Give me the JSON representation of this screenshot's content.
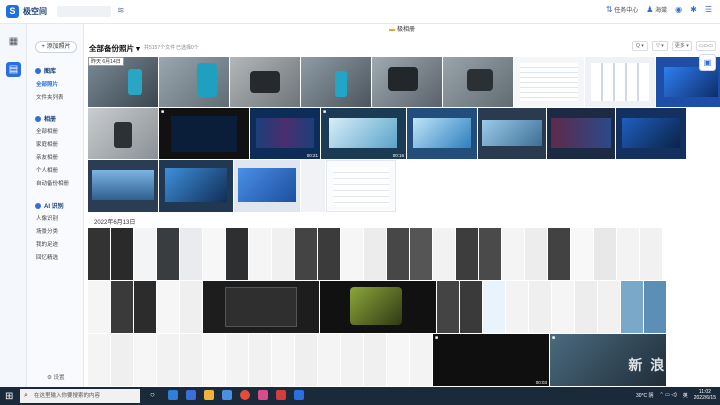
{
  "app": {
    "brand": "极空间",
    "window_title": "极相册"
  },
  "topbar": {
    "task_center": "任务中心",
    "user": "海棠",
    "task_icon": "tasks-icon",
    "bell_icon": "bell-icon",
    "gear_icon": "gear-icon",
    "user_icon": "user-icon"
  },
  "sidebar": {
    "add_button": "+ 添加照片",
    "sections": [
      {
        "label": "图库",
        "items": [
          "全部照片",
          "文件夹列表"
        ]
      },
      {
        "label": "相册",
        "items": [
          "全部相册",
          "家庭相册",
          "亲友相册",
          "个人相册",
          "自动备份相册"
        ]
      },
      {
        "label": "AI 识别",
        "items": [
          "人像识别",
          "场景分类",
          "我的足迹",
          "回忆精选"
        ]
      }
    ],
    "settings": "设置"
  },
  "toolbar": {
    "title": "全部备份照片 ▾",
    "count": "共5157个文件",
    "selected": "已选择0个",
    "buttons": [
      "Q ▾",
      "▽ ▾",
      "更多 ▾",
      "▭▭▭"
    ]
  },
  "grid": {
    "top_badge_day": "昨天",
    "top_badge_date": "6月14日",
    "durations": [
      "00:21",
      "00:16"
    ],
    "date_header": "2022年6月13日",
    "bottom_duration": "00:03"
  },
  "watermark": "新 浪 众 测",
  "taskbar": {
    "search_placeholder": "在这里输入你要搜索的内容",
    "weather": "30°C 阴",
    "time": "11:02",
    "date": "2022/6/15",
    "lang": "英"
  },
  "colors": {
    "accent": "#2a6fe0",
    "taskbar": "#1b2a3a"
  }
}
